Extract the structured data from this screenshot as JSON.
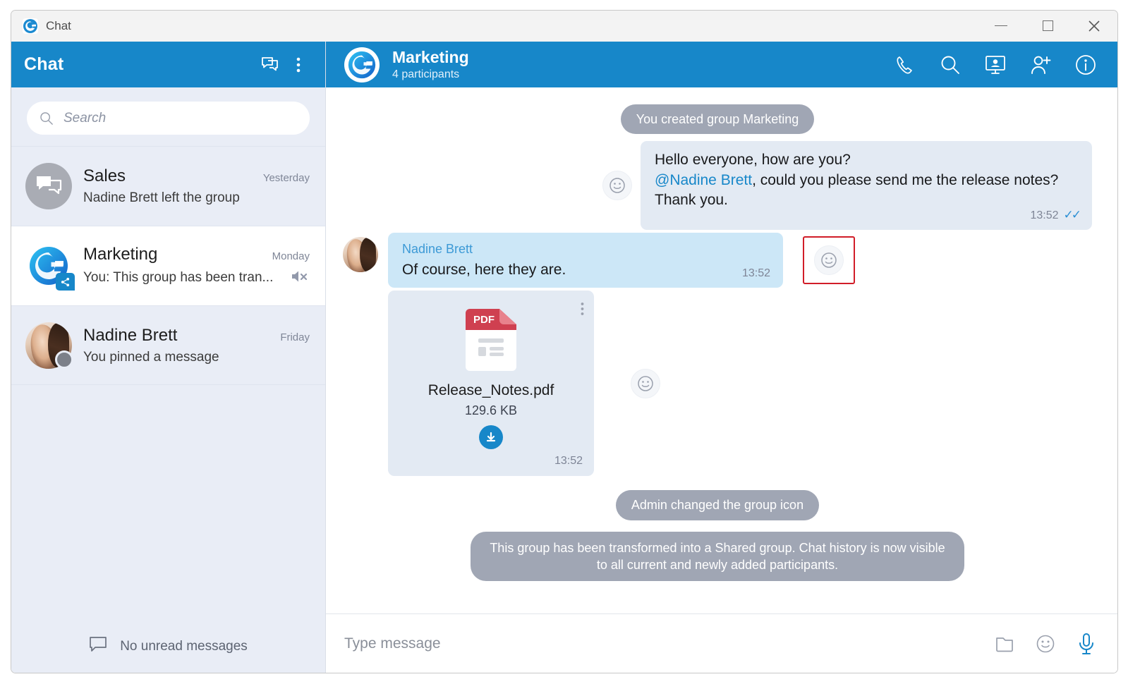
{
  "window": {
    "title": "Chat",
    "app_icon": "app-logo-icon",
    "controls": {
      "minimize": "minimize-icon",
      "maximize": "maximize-icon",
      "close": "close-icon"
    }
  },
  "sidebar": {
    "header": {
      "title": "Chat",
      "new_chat_icon": "new-chat-icon",
      "menu_icon": "more-vertical-icon"
    },
    "search": {
      "placeholder": "Search",
      "value": "",
      "icon": "search-icon"
    },
    "chats": [
      {
        "name": "Sales",
        "time": "Yesterday",
        "preview": "Nadine Brett left the group",
        "avatar_type": "group-chat-bubble",
        "selected": false,
        "muted": false,
        "status": null
      },
      {
        "name": "Marketing",
        "time": "Monday",
        "preview": "You: This group has been tran...",
        "avatar_type": "marketing-group-logo",
        "selected": true,
        "muted": true,
        "mute_icon": "speaker-mute-icon",
        "badge": "shared-group-badge",
        "status": null
      },
      {
        "name": "Nadine Brett",
        "time": "Friday",
        "preview": "You pinned a message",
        "avatar_type": "person-photo",
        "selected": false,
        "muted": false,
        "status": "offline"
      }
    ],
    "footer": {
      "label": "No unread messages",
      "icon": "chat-bubble-icon"
    }
  },
  "chat": {
    "header": {
      "title": "Marketing",
      "subtitle": "4 participants",
      "avatar": "marketing-group-logo",
      "icons": [
        {
          "name": "call-icon",
          "label": "Call"
        },
        {
          "name": "search-icon",
          "label": "Search"
        },
        {
          "name": "screen-share-icon",
          "label": "Screen share"
        },
        {
          "name": "add-participant-icon",
          "label": "Add participant"
        },
        {
          "name": "info-icon",
          "label": "Info"
        }
      ]
    },
    "messages": [
      {
        "type": "system",
        "text": "You created group Marketing"
      },
      {
        "type": "outgoing",
        "lines": [
          "Hello everyone, how are you?",
          "@Nadine Brett , could you please send me the release notes? Thank you."
        ],
        "mention": "@Nadine Brett",
        "text_before_mention": "Hello everyone, how are you?",
        "text_after_mention": ", could you please send me the release notes? Thank you.",
        "time": "13:52",
        "status_ticks": "✓✓",
        "react_icon": "emoji-smiley-icon"
      },
      {
        "type": "incoming",
        "sender": "Nadine Brett",
        "text": "Of course, here they are.",
        "time": "13:52",
        "react_icon": "emoji-smiley-icon",
        "highlighted": true
      },
      {
        "type": "file",
        "file_type": "PDF",
        "file_name": "Release_Notes.pdf",
        "file_size": "129.6 KB",
        "time": "13:52",
        "download_icon": "download-icon",
        "menu_icon": "more-vertical-icon",
        "react_icon": "emoji-smiley-icon"
      },
      {
        "type": "system",
        "text": "Admin changed the group icon"
      },
      {
        "type": "system",
        "text": "This group has been transformed into a Shared group. Chat history is now visible to all current and newly added participants."
      }
    ],
    "composer": {
      "placeholder": "Type message",
      "value": "",
      "icons": [
        {
          "name": "attach-folder-icon",
          "label": "Attach file"
        },
        {
          "name": "emoji-smiley-icon",
          "label": "Emoji"
        },
        {
          "name": "microphone-icon",
          "label": "Voice message"
        }
      ]
    }
  },
  "colors": {
    "brand_blue": "#1787c9",
    "sidebar_bg": "#e9edf6",
    "outgoing_bubble": "#e3eaf3",
    "incoming_bubble": "#cce7f7",
    "system_bubble": "#a0a6b4",
    "highlight_red": "#d11d28",
    "mention_blue": "#1787c9"
  }
}
